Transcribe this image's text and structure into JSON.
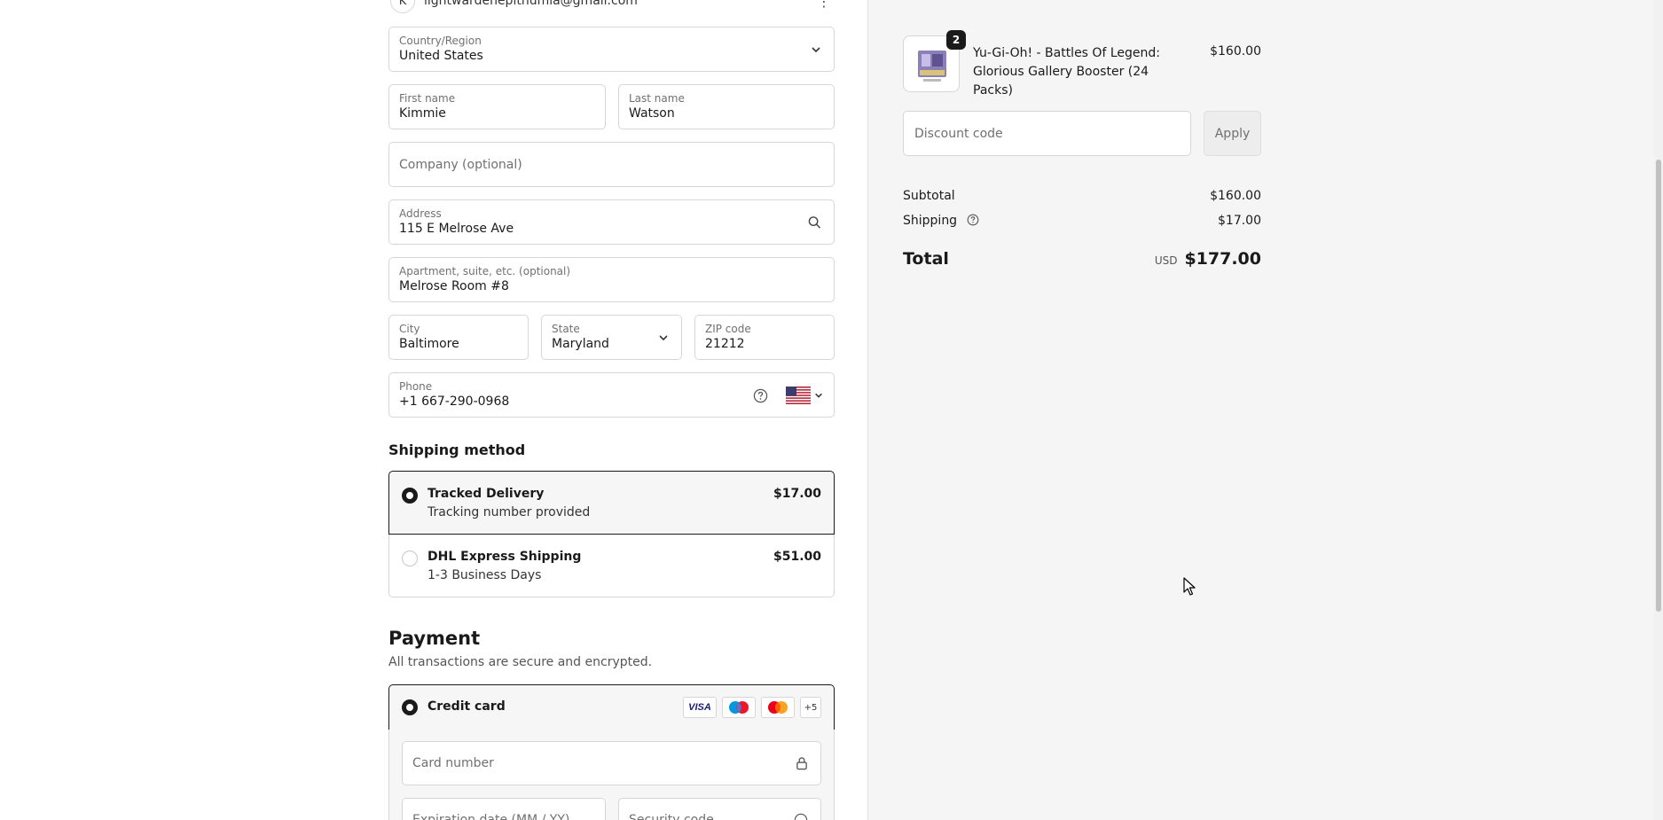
{
  "account": {
    "avatar_initial": "K",
    "email": "lightwardenepithumia@gmail.com"
  },
  "delivery": {
    "country": {
      "label": "Country/Region",
      "value": "United States"
    },
    "first_name": {
      "label": "First name",
      "value": "Kimmie"
    },
    "last_name": {
      "label": "Last name",
      "value": "Watson"
    },
    "company": {
      "placeholder": "Company (optional)"
    },
    "address": {
      "label": "Address",
      "value": "115 E Melrose Ave"
    },
    "apartment": {
      "label": "Apartment, suite, etc. (optional)",
      "value": "Melrose Room #8"
    },
    "city": {
      "label": "City",
      "value": "Baltimore"
    },
    "state": {
      "label": "State",
      "value": "Maryland"
    },
    "zip": {
      "label": "ZIP code",
      "value": "21212"
    },
    "phone": {
      "label": "Phone",
      "value": "+1 667-290-0968"
    }
  },
  "shipping": {
    "title": "Shipping method",
    "options": [
      {
        "name": "Tracked Delivery",
        "sub": "Tracking number provided",
        "price": "$17.00",
        "selected": true
      },
      {
        "name": "DHL Express Shipping",
        "sub": "1-3 Business Days",
        "price": "$51.00",
        "selected": false
      }
    ]
  },
  "payment": {
    "title": "Payment",
    "subtitle": "All transactions are secure and encrypted.",
    "method": "Credit card",
    "cards": {
      "visa": "VISA",
      "more": "+5"
    },
    "card_number_placeholder": "Card number",
    "expiry_placeholder": "Expiration date (MM / YY)",
    "security_placeholder": "Security code"
  },
  "summary": {
    "item": {
      "quantity": "2",
      "name": "Yu-Gi-Oh! - Battles Of Legend: Glorious Gallery Booster (24 Packs)",
      "price": "$160.00"
    },
    "discount_placeholder": "Discount code",
    "apply_label": "Apply",
    "subtotal_label": "Subtotal",
    "subtotal_value": "$160.00",
    "shipping_label": "Shipping",
    "shipping_value": "$17.00",
    "total_label": "Total",
    "currency": "USD",
    "total_value": "$177.00"
  },
  "colors": {
    "accent": "#1a1a1a",
    "summary_bg": "#f5f5f5",
    "border": "#d6d6d6"
  }
}
